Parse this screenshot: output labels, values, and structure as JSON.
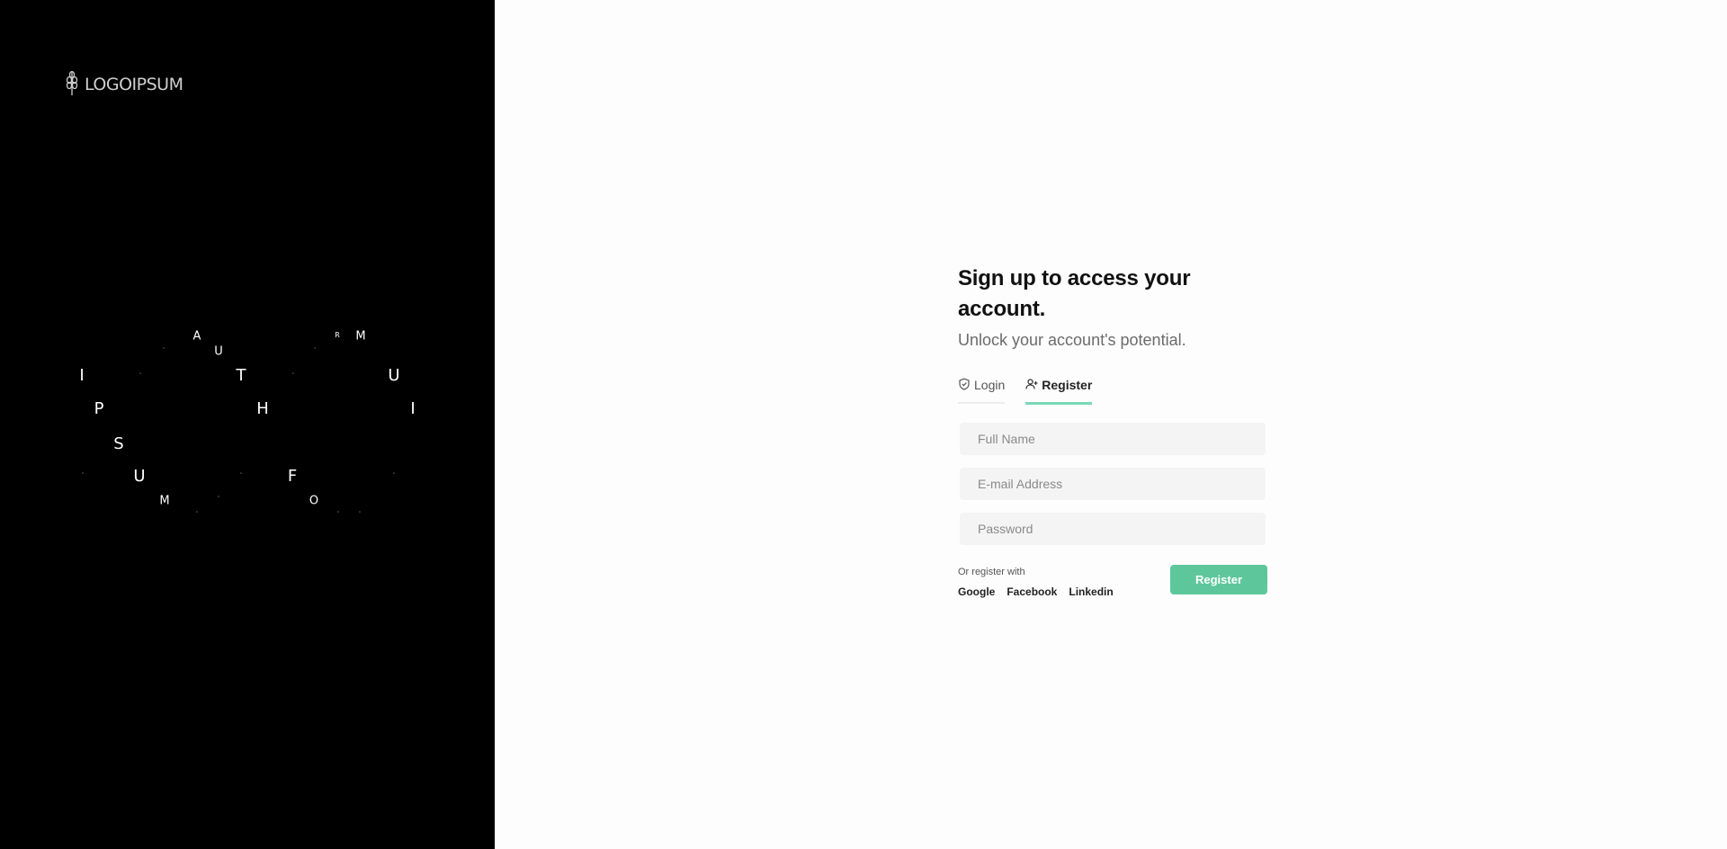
{
  "brand": {
    "logo_text": "LOGOIPSUM",
    "logo_icon": "wheat-icon"
  },
  "letter_art": [
    "I",
    "P",
    "S",
    "U",
    "M",
    "A",
    "U",
    "T",
    "H",
    "F",
    "O",
    "R",
    "M",
    "U",
    "I"
  ],
  "form": {
    "title": "Sign up to access your account.",
    "subtitle": "Unlock your account's potential.",
    "tabs": [
      {
        "label": "Login",
        "icon": "shield-icon",
        "active": false
      },
      {
        "label": "Register",
        "icon": "user-plus-icon",
        "active": true
      }
    ],
    "fields": {
      "full_name": {
        "placeholder": "Full Name",
        "value": ""
      },
      "email": {
        "placeholder": "E-mail Address",
        "value": ""
      },
      "password": {
        "placeholder": "Password",
        "value": ""
      }
    },
    "or_register_text": "Or register with",
    "socials": [
      "Google",
      "Facebook",
      "Linkedin"
    ],
    "submit_label": "Register"
  },
  "colors": {
    "accent": "#5dc79b",
    "tab_underline": "#7cd7b6",
    "left_panel_bg": "#000000",
    "page_bg": "#fdfdfd"
  }
}
